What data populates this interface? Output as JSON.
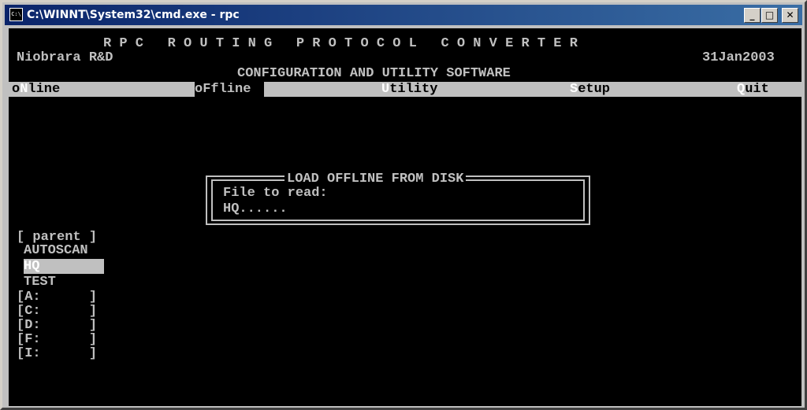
{
  "window": {
    "icon_label": "C:\\",
    "title": "C:\\WINNT\\System32\\cmd.exe - rpc",
    "buttons": {
      "minimize": "_",
      "maximize": "□",
      "close": "✕"
    }
  },
  "header": {
    "app_name": "R P C   R O U T I N G   P R O T O C O L   C O N V E R T E R",
    "company": "Niobrara R&D",
    "date": "31Jan2003",
    "subtitle": "CONFIGURATION AND UTILITY SOFTWARE"
  },
  "menu": {
    "online": {
      "key": "o",
      "hot": "N",
      "rest": "line"
    },
    "offline": {
      "key": "o",
      "hot": "F",
      "rest": "fline"
    },
    "utility": {
      "hot": "U",
      "rest": "tility"
    },
    "setup": {
      "hot": "S",
      "rest": "etup"
    },
    "quit": {
      "hot": "Q",
      "rest": "uit"
    }
  },
  "dialog": {
    "title": "LOAD OFFLINE FROM DISK",
    "prompt": "File to read:",
    "value": "HQ......"
  },
  "file_list": {
    "parent": "[ parent ]",
    "items": [
      "AUTOSCAN",
      "HQ",
      "TEST"
    ],
    "selected": "HQ",
    "drives": [
      "[A:      ]",
      "[C:      ]",
      "[D:      ]",
      "[F:      ]",
      "[I:      ]"
    ]
  }
}
